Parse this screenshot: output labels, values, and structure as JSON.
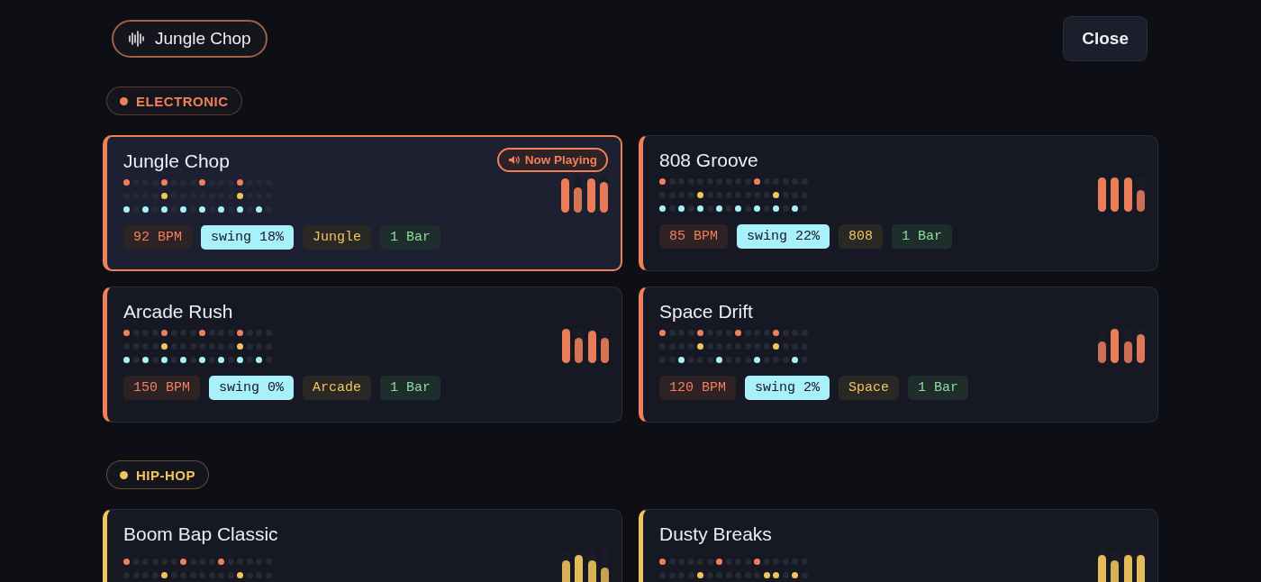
{
  "header": {
    "title": "Jungle Chop",
    "close": "Close"
  },
  "groups": [
    {
      "label": "ELECTRONIC",
      "color": "#f0805a",
      "cards": [
        {
          "title": "Jungle Chop",
          "selected": true,
          "badge": "Now Playing",
          "rows": [
            [
              true,
              false,
              false,
              false,
              true,
              false,
              false,
              false,
              true,
              false,
              false,
              false,
              true,
              false,
              false,
              false
            ],
            [
              false,
              false,
              false,
              false,
              true,
              false,
              false,
              false,
              false,
              false,
              false,
              false,
              true,
              false,
              false,
              false
            ],
            [
              true,
              false,
              true,
              false,
              true,
              false,
              true,
              false,
              true,
              false,
              true,
              false,
              true,
              false,
              true,
              false
            ]
          ],
          "bars": [
            {
              "level": 0.95
            },
            {
              "level": 0.7
            },
            {
              "level": 0.95
            },
            {
              "level": 0.85
            }
          ],
          "tags": [
            {
              "kind": "bpm",
              "text": "92 BPM"
            },
            {
              "kind": "swing",
              "text": "swing 18%"
            },
            {
              "kind": "genre",
              "text": "Jungle"
            },
            {
              "kind": "length",
              "text": "1 Bar"
            }
          ]
        },
        {
          "title": "808 Groove",
          "selected": false,
          "rows": [
            [
              true,
              false,
              false,
              false,
              false,
              false,
              false,
              false,
              false,
              false,
              true,
              false,
              false,
              false,
              false,
              false
            ],
            [
              false,
              false,
              false,
              false,
              true,
              false,
              false,
              false,
              false,
              false,
              false,
              false,
              true,
              false,
              false,
              false
            ],
            [
              true,
              false,
              true,
              false,
              true,
              false,
              true,
              false,
              true,
              false,
              true,
              false,
              true,
              false,
              true,
              false
            ]
          ],
          "bars": [
            {
              "level": 0.95
            },
            {
              "level": 0.95
            },
            {
              "level": 0.95
            },
            {
              "level": 0.6
            }
          ],
          "tags": [
            {
              "kind": "bpm",
              "text": "85 BPM"
            },
            {
              "kind": "swing",
              "text": "swing 22%"
            },
            {
              "kind": "genre",
              "text": "808"
            },
            {
              "kind": "length",
              "text": "1 Bar"
            }
          ]
        },
        {
          "title": "Arcade Rush",
          "selected": false,
          "rows": [
            [
              true,
              false,
              false,
              false,
              true,
              false,
              false,
              false,
              true,
              false,
              false,
              false,
              true,
              false,
              false,
              false
            ],
            [
              false,
              false,
              false,
              false,
              true,
              false,
              false,
              false,
              false,
              false,
              false,
              false,
              true,
              false,
              false,
              false
            ],
            [
              true,
              false,
              true,
              false,
              true,
              false,
              true,
              false,
              true,
              false,
              true,
              false,
              true,
              false,
              true,
              false
            ]
          ],
          "bars": [
            {
              "level": 0.95
            },
            {
              "level": 0.7
            },
            {
              "level": 0.9
            },
            {
              "level": 0.7
            }
          ],
          "tags": [
            {
              "kind": "bpm",
              "text": "150 BPM"
            },
            {
              "kind": "swing",
              "text": "swing 0%"
            },
            {
              "kind": "genre",
              "text": "Arcade"
            },
            {
              "kind": "length",
              "text": "1 Bar"
            }
          ]
        },
        {
          "title": "Space Drift",
          "selected": false,
          "rows": [
            [
              true,
              false,
              false,
              false,
              true,
              false,
              false,
              false,
              true,
              false,
              false,
              false,
              true,
              false,
              false,
              false
            ],
            [
              false,
              false,
              false,
              false,
              true,
              false,
              false,
              false,
              false,
              false,
              false,
              false,
              true,
              false,
              false,
              false
            ],
            [
              false,
              false,
              true,
              false,
              false,
              false,
              true,
              false,
              false,
              false,
              true,
              false,
              false,
              false,
              true,
              false
            ]
          ],
          "bars": [
            {
              "level": 0.6
            },
            {
              "level": 0.95
            },
            {
              "level": 0.6
            },
            {
              "level": 0.8
            }
          ],
          "tags": [
            {
              "kind": "bpm",
              "text": "120 BPM"
            },
            {
              "kind": "swing",
              "text": "swing 2%"
            },
            {
              "kind": "genre",
              "text": "Space"
            },
            {
              "kind": "length",
              "text": "1 Bar"
            }
          ]
        }
      ]
    },
    {
      "label": "HIP-HOP",
      "color": "#f2c55c",
      "cards": [
        {
          "title": "Boom Bap Classic",
          "selected": false,
          "rows": [
            [
              true,
              false,
              false,
              false,
              false,
              false,
              true,
              false,
              false,
              false,
              true,
              false,
              false,
              false,
              false,
              false
            ],
            [
              false,
              false,
              false,
              false,
              true,
              false,
              false,
              false,
              false,
              false,
              false,
              false,
              true,
              false,
              false,
              false
            ]
          ],
          "bars": [
            {
              "level": 0.7
            },
            {
              "level": 0.85
            },
            {
              "level": 0.7
            },
            {
              "level": 0.5
            }
          ]
        },
        {
          "title": "Dusty Breaks",
          "selected": false,
          "rows": [
            [
              true,
              false,
              false,
              false,
              false,
              false,
              true,
              false,
              false,
              false,
              true,
              false,
              false,
              false,
              false,
              false
            ],
            [
              false,
              false,
              false,
              false,
              true,
              false,
              false,
              false,
              false,
              false,
              false,
              true,
              true,
              false,
              true,
              false
            ]
          ],
          "bars": [
            {
              "level": 0.85
            },
            {
              "level": 0.7
            },
            {
              "level": 0.85
            },
            {
              "level": 0.85
            }
          ]
        }
      ]
    }
  ]
}
